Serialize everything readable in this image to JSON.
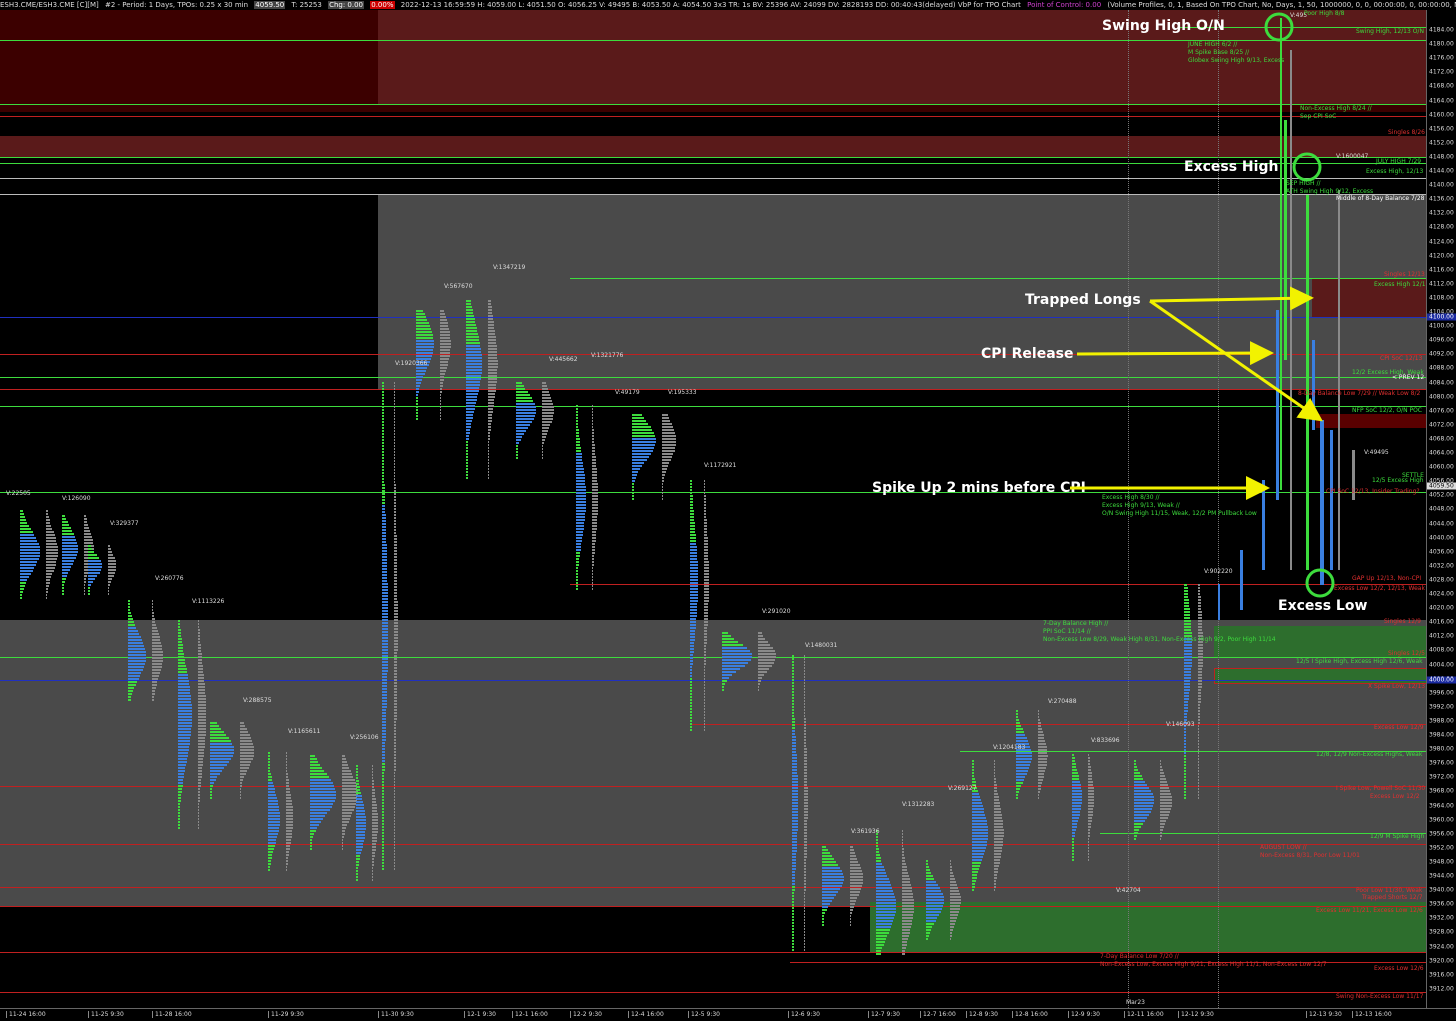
{
  "header": {
    "symbol": "ESH3.CME/ESH3.CME [C][M]",
    "chart_id": "#2 - Period: 1 Days, TPOs: 0.25 x 30 min",
    "last_price": "4059.50",
    "t_value": "T: 25253",
    "chg": "Chg: 0.00",
    "chg_red": "0.00%",
    "info": "2022-12-13 16:59:59 H: 4059.00 L: 4051.50 O: 4056.25 V: 49495 B: 4053.50 A: 4054.50 3x3 TR: 1s BV: 25396 AV: 24099 DV: 2828193 DD: 00:40:43(delayed) VbP for TPO Chart",
    "poc": "Point of Control: 0.00",
    "study": "(Volume Profiles, 0, 1, Based On TPO Chart, No, Days, 1, 50, 1000000, 0, 0, 00:00:00, 0, 00:00:00, No, No, Window Width, 70, No, None, 0, No)",
    "corner_value": "4185.00"
  },
  "y_axis": {
    "labels": [
      "4184.00",
      "4180.00",
      "4176.00",
      "4172.00",
      "4168.00",
      "4164.00",
      "4160.00",
      "4156.00",
      "4152.00",
      "4148.00",
      "4144.00",
      "4140.00",
      "4136.00",
      "4132.00",
      "4128.00",
      "4124.00",
      "4120.00",
      "4116.00",
      "4112.00",
      "4108.00",
      "4104.00",
      "4100.00",
      "4096.00",
      "4092.00",
      "4088.00",
      "4084.00",
      "4080.00",
      "4076.00",
      "4072.00",
      "4068.00",
      "4064.00",
      "4060.00",
      "4056.00",
      "4052.00",
      "4048.00",
      "4044.00",
      "4040.00",
      "4036.00",
      "4032.00",
      "4028.00",
      "4024.00",
      "4020.00",
      "4016.00",
      "4012.00",
      "4008.00",
      "4004.00",
      "4000.00",
      "3996.00",
      "3992.00",
      "3988.00",
      "3984.00",
      "3980.00",
      "3976.00",
      "3972.00",
      "3968.00",
      "3964.00",
      "3960.00",
      "3956.00",
      "3952.00",
      "3948.00",
      "3944.00",
      "3940.00",
      "3936.00",
      "3932.00",
      "3928.00",
      "3924.00",
      "3920.00",
      "3916.00",
      "3912.00"
    ],
    "price_flags": [
      "4100.00",
      "4059.50",
      "4000.00"
    ],
    "bottom_flag": "11:00"
  },
  "x_axis": {
    "labels": [
      "11-24 16:00",
      "11-25 9:30",
      "11-28 16:00",
      "11-29 9:30",
      "11-30 9:30",
      "12-1 9:30",
      "12-1 16:00",
      "12-2 9:30",
      "12-4 16:00",
      "12-5 9:30",
      "12-6 9:30",
      "12-7 9:30",
      "12-7 16:00",
      "12-8 9:30",
      "12-8 16:00",
      "12-9 9:30",
      "12-11 16:00",
      "12-12 9:30",
      "12-13 9:30",
      "12-13 16:00"
    ],
    "extra_label": "Mar23"
  },
  "volume_labels": [
    "V:22505",
    "V:126090",
    "V:329377",
    "V:260776",
    "V:1113226",
    "V:288575",
    "V:1165611",
    "V:256106",
    "V:1920366",
    "V:567670",
    "V:1347219",
    "V:445662",
    "V:1321776",
    "V:49179",
    "V:195333",
    "V:1172921",
    "V:291020",
    "V:1480031",
    "V:361936",
    "V:1312283",
    "V:269127",
    "V:1204183",
    "V:270488",
    "V:833696",
    "V:146093",
    "V:42704",
    "V:902220",
    "V:49495",
    "V:1600047",
    "V:495"
  ],
  "level_labels": {
    "swing_high_1213": "Swing High, 12/13 O/N",
    "poor_high": "Poor High 8/8",
    "june_high": "JUNE HIGH 6/2 //",
    "m_spike_base": "M Spike Base 8/25 //",
    "globex_swing_high": "Globex Swing High 9/13, Excess",
    "non_excess_high": "Non-Excess High 8/24 //",
    "sep_cpi_soc": "Sep CPI SoC",
    "singles_826": "Singles 8/26",
    "july_high": "JULY HIGH 7/29",
    "excess_high_1213": "Excess High, 12/13",
    "sep_high": "SEP HIGH //",
    "ath_swing_high": "ATH Swing High 9/12, Excess",
    "middle_8day": "Middle of 8-Day Balance 7/28",
    "singles_1213": "Singles 12/13",
    "excess_high_1213b": "Excess High 12/13",
    "cpi_soc": "CPI SoC 12/13",
    "excess_high_122": "12/2 Excess High, Weak",
    "prev": "< PREV 12",
    "balance_low": "8-Day Balance Low 7/29 // Weak Low 8/2",
    "nfp_soc": "NFP SoC 12/2, O/N POC",
    "settle": "SETTLE",
    "excess_high_125": "12/5 Excess High",
    "cpi_soc_insider": "CPI SoC 12/13, Insider Trading?",
    "excess_high_830": "Excess High 8/30 //",
    "excess_high_913": "Excess High 9/13, Weak //",
    "on_swing_high": "O/N Swing High 11/15, Weak, 12/2 PM Pullback Low",
    "gap_up": "GAP Up 12/13, Non-CPI",
    "excess_low_122": "Excess Low 12/2, 12/13, Weak",
    "singles_low": "Singles 12/9",
    "seven_day_balance_high": "7-Day Balance High //",
    "ppi_soc": "PPI SoC 11/14 //",
    "non_excess_low": "Non-Excess Low 8/29, Weak High 8/31, Non-Excess High 9/2, Poor High 11/14",
    "singles_125": "Singles 12/5",
    "spike_high_125": "12/5 I Spike High, Excess High 12/6, Weak",
    "x_spike_low": "X Spike Low, 12/13",
    "excess_low_129": "Excess Low 12/9",
    "non_excess_highs": "12/8, 12/9 Non-Excess Highs, Weak",
    "spike_low_powell": "I Spike Low, Powell SoC 11/30",
    "excess_low_122b": "Excess Low 12/2",
    "m_spike_high": "12/9 M Spike High",
    "august_low": "AUGUST LOW //",
    "non_excess_831": "Non-Excess 8/31, Poor Low 11/01",
    "poor_low_1130": "Poor Low 11/30, Weak",
    "trapped_shorts": "Trapped Shorts 12/7",
    "excess_low_1121": "Excess Low 11/21, Excess Low 12/6",
    "seven_day_balance_low": "7-Day Balance Low 7/20 //",
    "non_excess_low_2": "Non-Excess Low, Excess High 9/21, Excess High 11/1, Non-Excess Low 12/7",
    "excess_low_126": "Excess Low 12/6",
    "swing_non_excess_low": "Swing Non-Excess Low 11/17"
  },
  "annotations": {
    "swing_high_on": "Swing High O/N",
    "excess_high": "Excess High",
    "trapped_longs": "Trapped Longs",
    "cpi_release": "CPI Release",
    "spike_up": "Spike Up 2 mins before CPI",
    "excess_low": "Excess Low"
  },
  "colors": {
    "background": "#000000",
    "zone_red": "#5a1414",
    "zone_dark_red": "#3c0000",
    "zone_gray": "#4a4a4a",
    "zone_green": "#2d6e2d",
    "line_green": "#3ddc3d",
    "line_red": "#c02020",
    "line_blue": "#2030c0",
    "profile_blue": "#3a7fe0",
    "profile_green": "#3ddc3d",
    "volume_gray": "#8a8a8a",
    "annotation_yellow": "#f2f200"
  }
}
